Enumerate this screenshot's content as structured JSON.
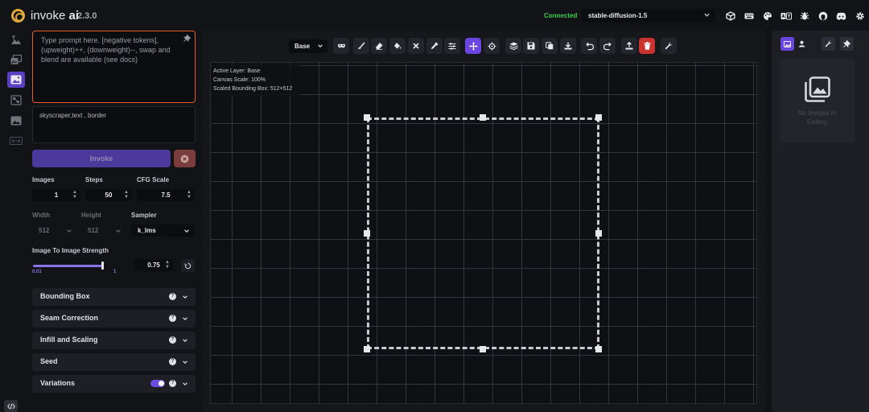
{
  "header": {
    "app_name_prefix": "invoke",
    "app_name_suffix": "ai",
    "version": "2.3.0",
    "status": "Connected",
    "model": "stable-diffusion-1.5",
    "icons": [
      "cube-icon",
      "keyboard-icon",
      "palette-icon",
      "translate-icon",
      "bug-icon",
      "github-icon",
      "discord-icon",
      "gear-icon"
    ]
  },
  "rail": {
    "items": [
      "text-to-image-icon",
      "image-to-image-icon",
      "unified-canvas-icon",
      "nodes-icon",
      "postprocessing-icon",
      "training-icon"
    ],
    "active_index": 2
  },
  "prompt": {
    "placeholder": "Type prompt here. [negative tokens], (upweight)++, (downweight)--, swap and blend are available (see docs)",
    "negative_value": "skyscraper,text , border"
  },
  "actions": {
    "invoke_label": "Invoke"
  },
  "params": {
    "images_label": "Images",
    "images_value": "1",
    "steps_label": "Steps",
    "steps_value": "50",
    "cfg_label": "CFG Scale",
    "cfg_value": "7.5",
    "width_label": "Width",
    "width_value": "512",
    "height_label": "Height",
    "height_value": "512",
    "sampler_label": "Sampler",
    "sampler_value": "k_lms",
    "strength_label": "Image To Image Strength",
    "strength_value": "0.75",
    "strength_min": "0.01",
    "strength_max": "1",
    "strength_fraction": 0.75
  },
  "accordions": [
    {
      "label": "Bounding Box"
    },
    {
      "label": "Seam Correction"
    },
    {
      "label": "Infill and Scaling"
    },
    {
      "label": "Seed"
    },
    {
      "label": "Variations",
      "toggle_on": true
    }
  ],
  "canvas": {
    "layer": "Base",
    "info_layer": "Active Layer: Base",
    "info_scale": "Canvas Scale: 100%",
    "info_bbox": "Scaled Bounding Box: 512×512"
  },
  "gallery": {
    "empty_line1": "No Images In",
    "empty_line2": "Gallery"
  },
  "colors": {
    "accent": "#6a45e0",
    "prompt_border": "#e85d2a",
    "status_green": "#3fd04b",
    "delete_red": "#c8322f"
  }
}
